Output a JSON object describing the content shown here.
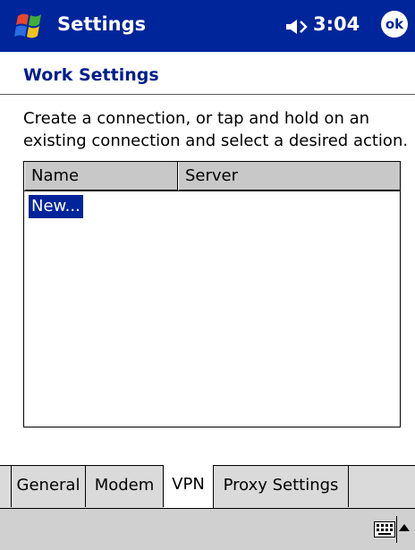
{
  "titlebar": {
    "app_title": "Settings",
    "time": "3:04",
    "ok_label": "ok",
    "background": "#00259a",
    "icons": {
      "start": "windows-flag-icon",
      "volume": "speaker-icon"
    }
  },
  "header": {
    "title": "Work Settings"
  },
  "instructions": "Create a connection, or tap and hold on an existing connection and select a desired action.",
  "list": {
    "columns": [
      "Name",
      "Server"
    ],
    "items": [
      {
        "name": "New...",
        "server": "",
        "selected": true
      }
    ]
  },
  "tabs": [
    {
      "label": "General",
      "active": false
    },
    {
      "label": "Modem",
      "active": false
    },
    {
      "label": "VPN",
      "active": true
    },
    {
      "label": "Proxy Settings",
      "active": false
    }
  ],
  "menubar": {
    "icons": [
      "keyboard-icon",
      "up-arrow-icon"
    ]
  },
  "colors": {
    "accent": "#00259a",
    "heading": "#001e8c",
    "panel": "#dadada"
  }
}
